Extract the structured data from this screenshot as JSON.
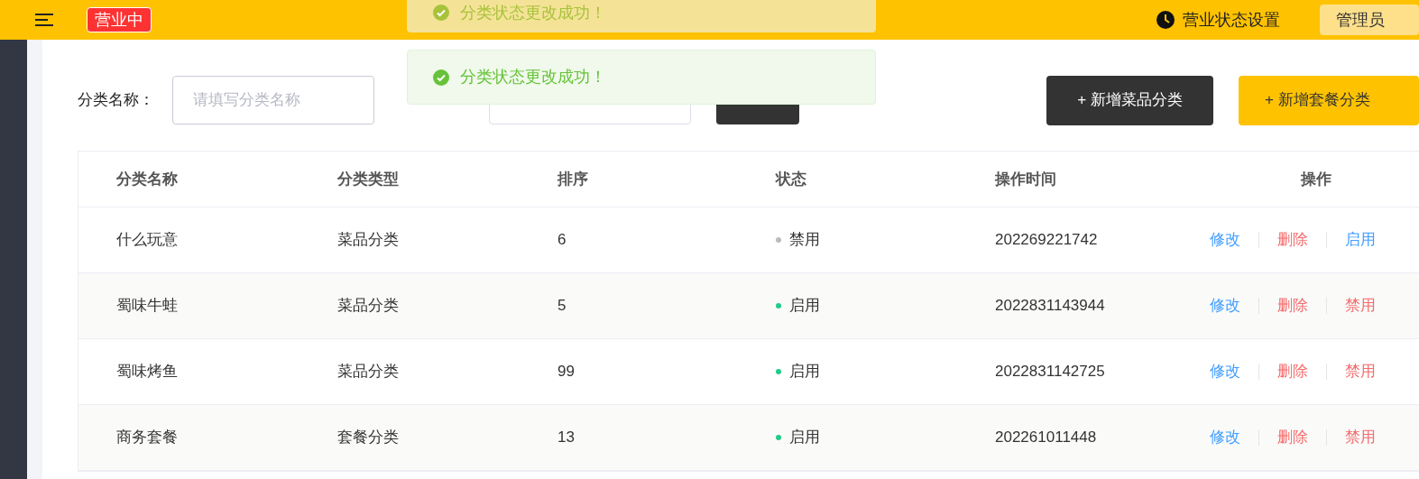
{
  "header": {
    "status_badge": "营业中",
    "status_setting": "营业状态设置",
    "user": "管理员"
  },
  "toasts": [
    {
      "message": "分类状态更改成功！",
      "faded": true
    },
    {
      "message": "分类状态更改成功！",
      "faded": false
    }
  ],
  "filters": {
    "name_label": "分类名称：",
    "name_placeholder": "请填写分类名称"
  },
  "actions": [
    "+ 新增菜品分类",
    "+ 新增套餐分类"
  ],
  "table": {
    "columns": [
      "分类名称",
      "分类类型",
      "排序",
      "状态",
      "操作时间",
      "操作"
    ],
    "rows": [
      {
        "name": "什么玩意",
        "type": "菜品分类",
        "sort": "6",
        "enabled": false,
        "status": "禁用",
        "time": "202269221742",
        "edit": "修改",
        "delete": "删除",
        "toggle": "启用"
      },
      {
        "name": "蜀味牛蛙",
        "type": "菜品分类",
        "sort": "5",
        "enabled": true,
        "status": "启用",
        "time": "2022831143944",
        "edit": "修改",
        "delete": "删除",
        "toggle": "禁用"
      },
      {
        "name": "蜀味烤鱼",
        "type": "菜品分类",
        "sort": "99",
        "enabled": true,
        "status": "启用",
        "time": "2022831142725",
        "edit": "修改",
        "delete": "删除",
        "toggle": "禁用"
      },
      {
        "name": "商务套餐",
        "type": "套餐分类",
        "sort": "13",
        "enabled": true,
        "status": "启用",
        "time": "202261011448",
        "edit": "修改",
        "delete": "删除",
        "toggle": "禁用"
      }
    ]
  }
}
